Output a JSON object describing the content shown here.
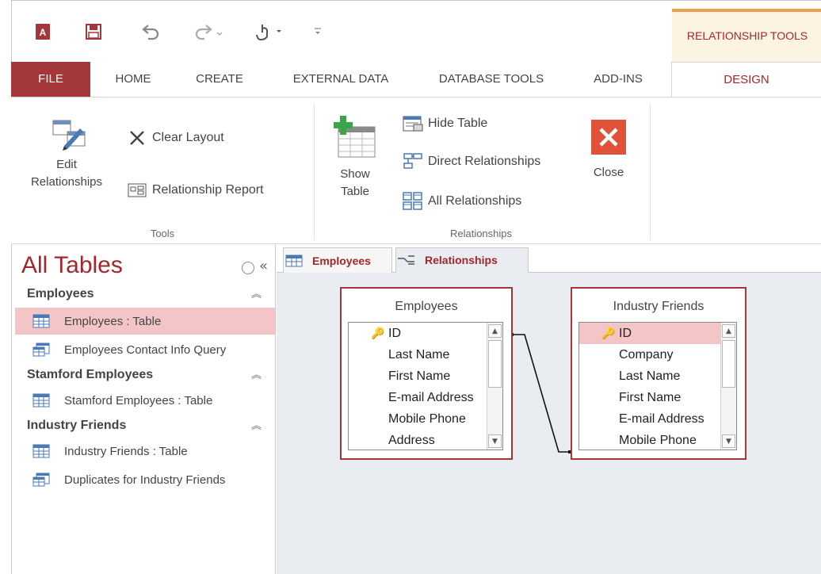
{
  "contextual_title": "RELATIONSHIP TOOLS",
  "tabs": {
    "file": "FILE",
    "home": "HOME",
    "create": "CREATE",
    "external_data": "EXTERNAL DATA",
    "database_tools": "DATABASE TOOLS",
    "add_ins": "ADD-INS",
    "design": "DESIGN"
  },
  "ribbon": {
    "edit_relationships": [
      "Edit",
      "Relationships"
    ],
    "clear_layout": "Clear Layout",
    "relationship_report": "Relationship Report",
    "tools_group": "Tools",
    "show_table": [
      "Show",
      "Table"
    ],
    "hide_table": "Hide Table",
    "direct_relationships": "Direct Relationships",
    "all_relationships": "All Relationships",
    "close": "Close",
    "relationships_group": "Relationships"
  },
  "nav": {
    "title": "All Tables",
    "groups": [
      {
        "name": "Employees",
        "items": [
          {
            "label": "Employees : Table",
            "type": "table",
            "selected": true
          },
          {
            "label": "Employees Contact Info Query",
            "type": "query"
          }
        ]
      },
      {
        "name": "Stamford Employees",
        "items": [
          {
            "label": "Stamford Employees : Table",
            "type": "table"
          }
        ]
      },
      {
        "name": "Industry Friends",
        "items": [
          {
            "label": "Industry Friends : Table",
            "type": "table"
          },
          {
            "label": "Duplicates for Industry Friends",
            "type": "query"
          }
        ]
      }
    ]
  },
  "doc_tabs": {
    "employees": "Employees",
    "relationships": "Relationships"
  },
  "tables": {
    "employees": {
      "title": "Employees",
      "fields": [
        "ID",
        "Last Name",
        "First Name",
        "E-mail Address",
        "Mobile Phone",
        "Address"
      ]
    },
    "industry_friends": {
      "title": "Industry Friends",
      "fields": [
        "ID",
        "Company",
        "Last Name",
        "First Name",
        "E-mail Address",
        "Mobile Phone"
      ]
    }
  },
  "colors": {
    "accent": "#a4373a",
    "selected": "#f4c5c7",
    "contextual": "#fdf3e3"
  }
}
